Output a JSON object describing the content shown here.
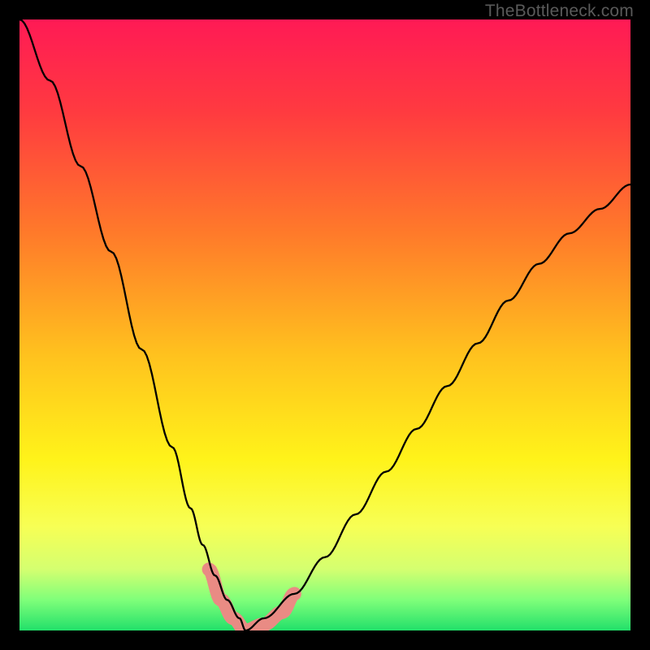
{
  "watermark": "TheBottleneck.com",
  "chart_data": {
    "type": "line",
    "title": "",
    "xlabel": "",
    "ylabel": "",
    "xlim": [
      0,
      100
    ],
    "ylim": [
      0,
      100
    ],
    "note": "V-shaped bottleneck curve. x-axis represents a hardware balance parameter; y-axis represents bottleneck percentage. Minimum (optimal balance) occurs near x≈37 where bottleneck≈0. Background gradient encodes severity: red (high) at top through orange/yellow to green (low) at bottom.",
    "series": [
      {
        "name": "bottleneck-left",
        "x": [
          0,
          5,
          10,
          15,
          20,
          25,
          28,
          30,
          32,
          34,
          36,
          37
        ],
        "values": [
          100,
          90,
          76,
          62,
          46,
          30,
          20,
          14,
          9,
          5,
          2,
          0
        ]
      },
      {
        "name": "bottleneck-right",
        "x": [
          37,
          40,
          45,
          50,
          55,
          60,
          65,
          70,
          75,
          80,
          85,
          90,
          95,
          100
        ],
        "values": [
          0,
          2,
          6,
          12,
          19,
          26,
          33,
          40,
          47,
          54,
          60,
          65,
          69,
          73
        ]
      }
    ],
    "gradient_stops": [
      {
        "pos": 0.0,
        "color": "#ff1a55"
      },
      {
        "pos": 0.15,
        "color": "#ff3a40"
      },
      {
        "pos": 0.35,
        "color": "#ff7a2a"
      },
      {
        "pos": 0.55,
        "color": "#ffc21e"
      },
      {
        "pos": 0.72,
        "color": "#fff31a"
      },
      {
        "pos": 0.83,
        "color": "#f7ff55"
      },
      {
        "pos": 0.9,
        "color": "#d4ff70"
      },
      {
        "pos": 0.95,
        "color": "#7fff7a"
      },
      {
        "pos": 1.0,
        "color": "#22e06a"
      }
    ],
    "dip_markers": {
      "note": "soft pink curve markers near the dip bottom",
      "color": "#e98b84",
      "points": [
        {
          "x": 31,
          "y": 10
        },
        {
          "x": 33,
          "y": 5
        },
        {
          "x": 35,
          "y": 2
        },
        {
          "x": 37,
          "y": 0
        },
        {
          "x": 40,
          "y": 1
        },
        {
          "x": 43,
          "y": 3
        },
        {
          "x": 45,
          "y": 6
        }
      ]
    }
  }
}
